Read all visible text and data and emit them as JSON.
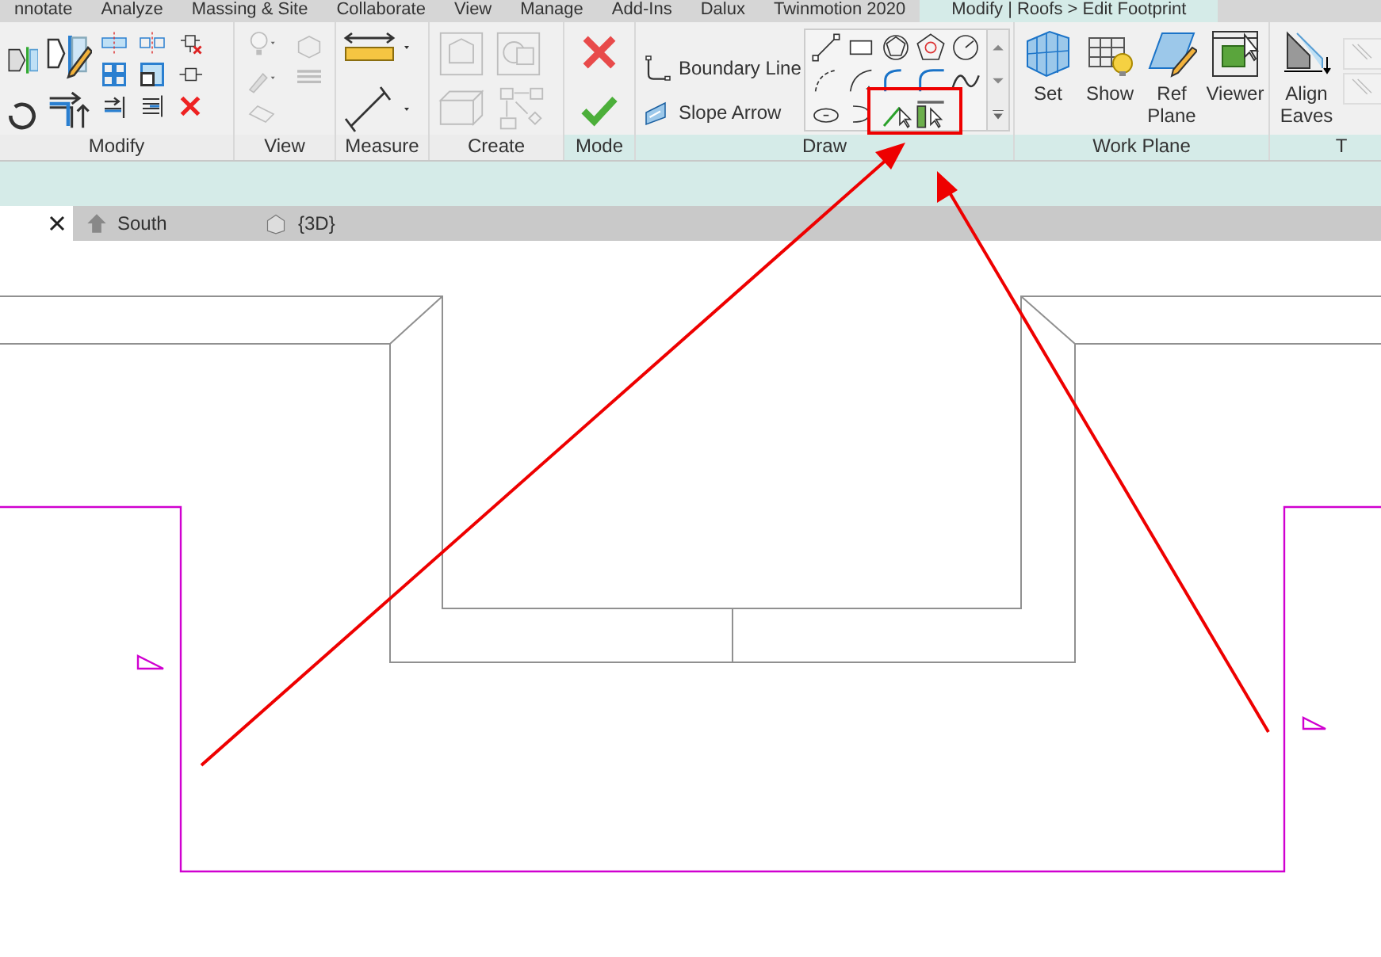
{
  "ribbon_tabs": [
    {
      "label": "nnotate",
      "selected": false
    },
    {
      "label": "Analyze",
      "selected": false
    },
    {
      "label": "Massing & Site",
      "selected": false
    },
    {
      "label": "Collaborate",
      "selected": false
    },
    {
      "label": "View",
      "selected": false
    },
    {
      "label": "Manage",
      "selected": false
    },
    {
      "label": "Add-Ins",
      "selected": false
    },
    {
      "label": "Dalux",
      "selected": false
    },
    {
      "label": "Twinmotion 2020",
      "selected": false
    },
    {
      "label": "Modify | Roofs > Edit Footprint",
      "selected": true
    }
  ],
  "modify_panel": {
    "title": "Modify"
  },
  "view_panel": {
    "title": "View"
  },
  "measure_panel": {
    "title": "Measure"
  },
  "create_panel": {
    "title": "Create"
  },
  "mode_panel": {
    "title": "Mode"
  },
  "draw_panel": {
    "title": "Draw",
    "buttons": [
      {
        "label": "Boundary Line"
      },
      {
        "label": "Slope Arrow"
      }
    ]
  },
  "work_plane_panel": {
    "title": "Work Plane",
    "buttons": [
      {
        "label": "Set"
      },
      {
        "label": "Show"
      },
      {
        "label": "Ref Plane"
      },
      {
        "label": "Viewer"
      }
    ]
  },
  "eaves_panel": {
    "title": "T",
    "button": {
      "label": "Align Eaves"
    },
    "small_buttons": [
      {
        "disabled": true
      },
      {
        "disabled": true
      }
    ]
  },
  "view_tabs": [
    {
      "label": "South",
      "kind": "elevation"
    },
    {
      "label": "{3D}",
      "kind": "threeD"
    }
  ]
}
